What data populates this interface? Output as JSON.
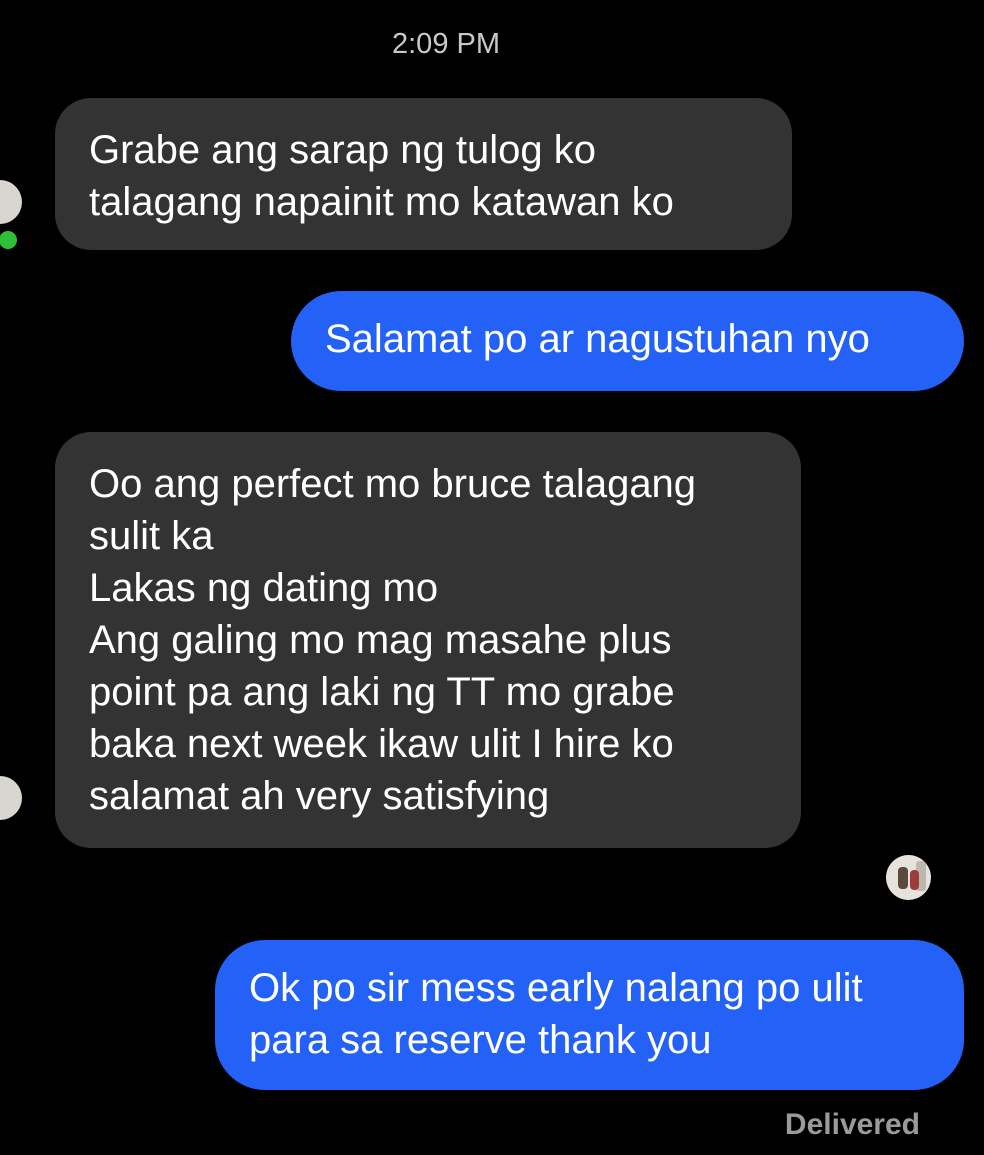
{
  "conversation": {
    "timestamp": "2:09 PM",
    "messages": [
      {
        "sender": "contact",
        "lines": [
          "Grabe ang sarap ng tulog ko",
          "talagang napainit mo katawan  ko"
        ]
      },
      {
        "sender": "me",
        "lines": [
          "Salamat po ar nagustuhan nyo"
        ]
      },
      {
        "sender": "contact",
        "lines": [
          "Oo ang perfect mo bruce talagang",
          "sulit ka",
          "Lakas ng dating mo",
          "Ang galing mo mag masahe plus",
          "point pa ang laki ng TT mo grabe",
          "baka next week ikaw ulit I hire ko",
          "salamat ah very satisfying"
        ]
      },
      {
        "sender": "me",
        "lines": [
          "Ok po sir mess early nalang po ulit",
          "para sa reserve thank you"
        ]
      }
    ],
    "status": "Delivered"
  },
  "colors": {
    "background": "#000000",
    "incoming_bubble": "#333333",
    "outgoing_bubble": "#2461f6",
    "online": "#2fbf38"
  },
  "icons": {
    "contact_avatar": "contact-avatar-icon",
    "online_indicator": "online-dot-icon",
    "seen_avatar": "seen-avatar-icon"
  }
}
